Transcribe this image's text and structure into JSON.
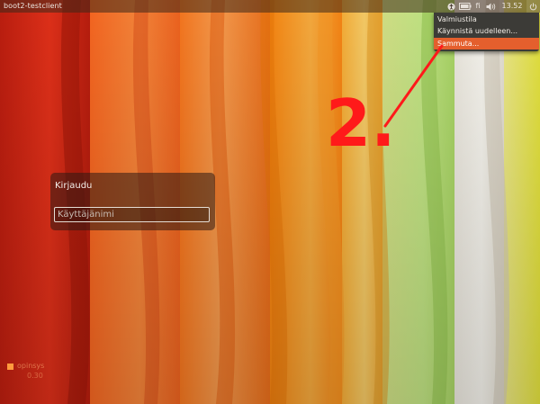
{
  "topbar": {
    "hostname": "boot2-testclient",
    "keyboard_layout": "fi",
    "clock": "13.52",
    "icons": [
      "accessibility-icon",
      "battery-icon",
      "keyboard-icon",
      "volume-icon",
      "power-icon"
    ]
  },
  "session_menu": {
    "items": [
      {
        "label": "Valmiustila"
      },
      {
        "label": "Käynnistä uudelleen..."
      },
      {
        "label": "Sammuta..."
      }
    ],
    "highlighted": "Sammuta..."
  },
  "annotation": {
    "step": "2.",
    "color": "#ff1a1a"
  },
  "login": {
    "title": "Kirjaudu",
    "username_placeholder": "Käyttäjänimi",
    "username_value": ""
  },
  "branding": {
    "text": "opinsys",
    "sub": "0.30"
  },
  "colors": {
    "menu_bg": "#3c3b37",
    "menu_highlight": "#e45f2d",
    "annotation": "#ff1a1a"
  }
}
